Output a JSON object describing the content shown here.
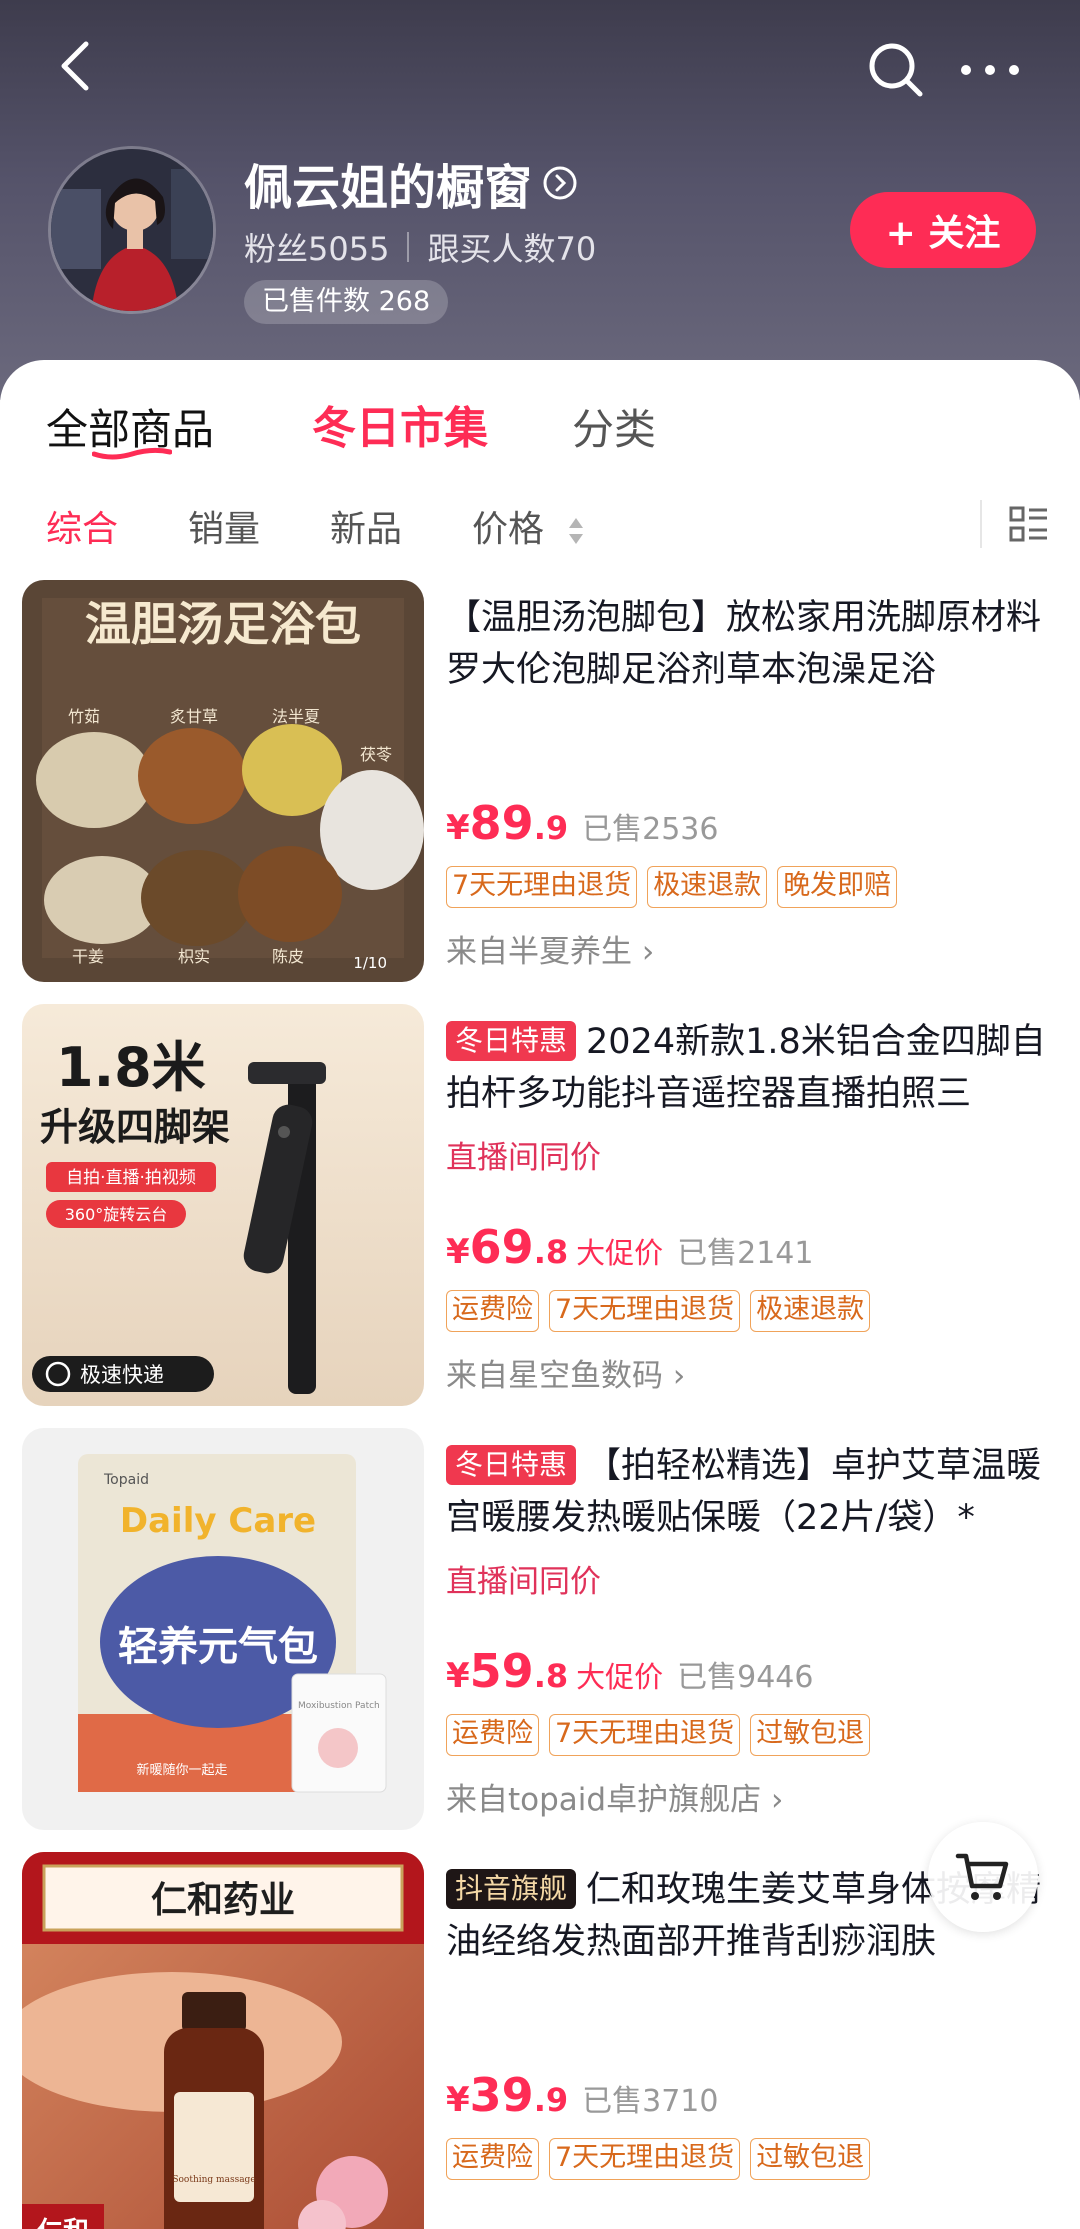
{
  "shop": {
    "name": "佩云姐的橱窗",
    "fans": "粉丝5055",
    "buyers": "跟买人数70",
    "sold": "已售件数 268",
    "follow_label": "+ 关注"
  },
  "tabs": {
    "all": "全部商品",
    "winter": "冬日市集",
    "category": "分类"
  },
  "filters": {
    "general": "综合",
    "sales": "销量",
    "new": "新品",
    "price": "价格"
  },
  "products": [
    {
      "title": "【温胆汤泡脚包】放松家用洗脚原材料罗大伦泡脚足浴剂草本泡澡足浴",
      "img_text": "温胆汤足浴包",
      "img_labels": [
        "竹茹",
        "炙甘草",
        "法半夏",
        "茯苓",
        "干姜",
        "枳实",
        "陈皮"
      ],
      "img_counter": "1/10",
      "price_cur": "¥",
      "price_int": "89",
      "price_dec": ".9",
      "sold": "已售2536",
      "badges": [
        "7天无理由退货",
        "极速退款",
        "晚发即赔"
      ],
      "store": "来自半夏养生 ›"
    },
    {
      "tag": "冬日特惠",
      "title": "2024新款1.8米铝合金四脚自拍杆多功能抖音遥控器直播拍照三",
      "live_price": "直播间同价",
      "img_title1": "1.8米",
      "img_title2": "升级四脚架",
      "img_chip1": "自拍·直播·拍视频",
      "img_chip2": "360°旋转云台",
      "img_delivery": "极速快递",
      "price_cur": "¥",
      "price_int": "69",
      "price_dec": ".8",
      "price_promo": "大促价",
      "sold": "已售2141",
      "badges": [
        "运费险",
        "7天无理由退货",
        "极速退款"
      ],
      "store": "来自星空鱼数码 ›"
    },
    {
      "tag": "冬日特惠",
      "title": "【拍轻松精选】卓护艾草温暖宫暖腰发热暖贴保暖（22片/袋）*",
      "live_price": "直播间同价",
      "img_brand": "Topaid",
      "img_en": "Daily Care",
      "img_cn": "轻养元气包",
      "img_patch": "Moxibustion Patch",
      "img_foot": "新暖随你一起走",
      "price_cur": "¥",
      "price_int": "59",
      "price_dec": ".8",
      "price_promo": "大促价",
      "sold": "已售9446",
      "badges": [
        "运费险",
        "7天无理由退货",
        "过敏包退"
      ],
      "store": "来自topaid卓护旗舰店 ›"
    },
    {
      "tag": "抖音旗舰",
      "title": "仁和玫瑰生姜艾草身体按摩精油经络发热面部开推背刮痧润肤",
      "img_brand": "仁和药业",
      "img_corner": "仁和",
      "img_bottle": "Soothing massage",
      "price_cur": "¥",
      "price_int": "39",
      "price_dec": ".9",
      "sold": "已售3710",
      "badges": [
        "运费险",
        "7天无理由退货",
        "过敏包退"
      ]
    }
  ],
  "colors": {
    "accent": "#fe2c55",
    "badge_border": "#f0a35a",
    "badge_text": "#d8691c"
  },
  "icons": [
    "back-icon",
    "search-icon",
    "more-icon",
    "verified-arrow-icon",
    "sort-icon",
    "grid-icon",
    "cart-icon"
  ]
}
